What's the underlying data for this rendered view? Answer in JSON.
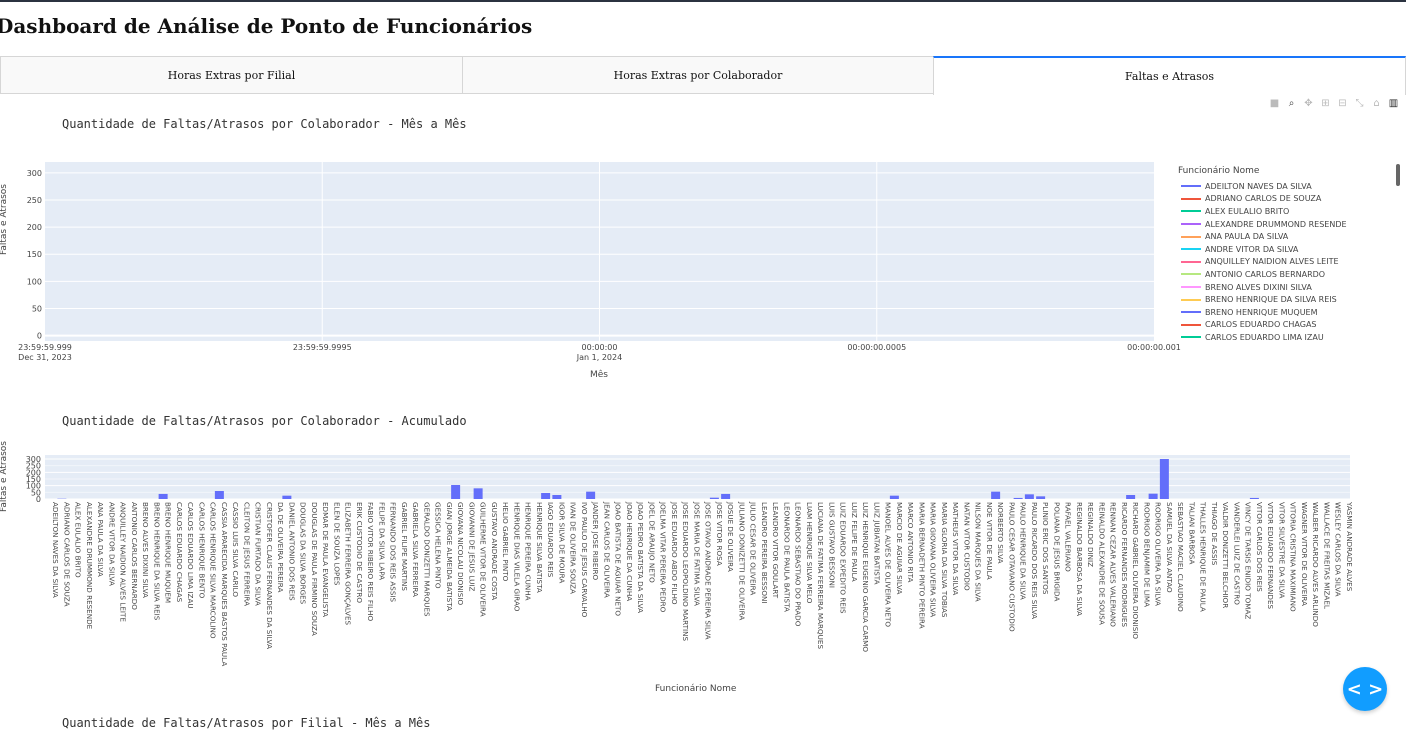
{
  "page_title": "Dashboard de Análise de Ponto de Funcionários",
  "tabs": [
    {
      "label": "Horas Extras por Filial",
      "active": false
    },
    {
      "label": "Horas Extras por Colaborador",
      "active": false
    },
    {
      "label": "Faltas e Atrasos",
      "active": true
    }
  ],
  "modebar_icons": [
    "camera-icon",
    "zoom-icon",
    "pan-icon",
    "zoom-in-icon",
    "zoom-out-icon",
    "autoscale-icon",
    "reset-axes-icon",
    "plotly-logo-icon"
  ],
  "nav_button": {
    "label": "< >",
    "icon": "code-arrows-icon",
    "color": "#119dff"
  },
  "chart_data": [
    {
      "type": "line",
      "title": "Quantidade de Faltas/Atrasos por Colaborador - Mês a Mês",
      "xlabel": "Mês",
      "ylabel": "Faltas e Atrasos",
      "ylim": [
        -10,
        320
      ],
      "yticks": [
        0,
        50,
        100,
        150,
        200,
        250,
        300
      ],
      "xticks": [
        {
          "label": "23:59:59.999",
          "sublabel": "Dec 31, 2023"
        },
        {
          "label": "23:59:59.9995",
          "sublabel": ""
        },
        {
          "label": "00:00:00",
          "sublabel": "Jan 1, 2024"
        },
        {
          "label": "00:00:00.0005",
          "sublabel": ""
        },
        {
          "label": "00:00:00.001",
          "sublabel": ""
        }
      ],
      "grid": true,
      "legend_title": "Funcionário Nome",
      "legend_position": "right",
      "series": [
        {
          "name": "ADEILTON NAVES DA SILVA",
          "color": "#636efa"
        },
        {
          "name": "ADRIANO CARLOS DE SOUZA",
          "color": "#ef553b"
        },
        {
          "name": "ALEX EULALIO BRITO",
          "color": "#00cc96"
        },
        {
          "name": "ALEXANDRE DRUMMOND RESENDE",
          "color": "#ab63fa"
        },
        {
          "name": "ANA PAULA DA SILVA",
          "color": "#ffa15a"
        },
        {
          "name": "ANDRE VITOR DA SILVA",
          "color": "#19d3f3"
        },
        {
          "name": "ANQUILLEY NAIDION ALVES LEITE",
          "color": "#ff6692"
        },
        {
          "name": "ANTONIO CARLOS BERNARDO",
          "color": "#b6e880"
        },
        {
          "name": "BRENO ALVES DIXINI SILVA",
          "color": "#ff97ff"
        },
        {
          "name": "BRENO HENRIQUE DA SILVA REIS",
          "color": "#fecb52"
        },
        {
          "name": "BRENO HENRIQUE MUQUEM",
          "color": "#636efa"
        },
        {
          "name": "CARLOS EDUARDO CHAGAS",
          "color": "#ef553b"
        },
        {
          "name": "CARLOS EDUARDO LIMA IZAU",
          "color": "#00cc96"
        }
      ]
    },
    {
      "type": "bar",
      "title": "Quantidade de Faltas/Atrasos por Colaborador - Acumulado",
      "xlabel": "Funcionário Nome",
      "ylabel": "Faltas e Atrasos",
      "ylim": [
        0,
        330
      ],
      "yticks": [
        0,
        100,
        200,
        300
      ],
      "yticks_minor": [
        50,
        150,
        250
      ],
      "color": "#636efa",
      "categories": [
        "ADEILTON NAVES DA SILVA",
        "ADRIANO CARLOS DE SOUZA",
        "ALEX EULALIO BRITO",
        "ALEXANDRE DRUMMOND RESENDE",
        "ANA PAULA DA SILVA",
        "ANDRE VITOR DA SILVA",
        "ANQUILLEY NAIDION ALVES LEITE",
        "ANTONIO CARLOS BERNARDO",
        "BRENO ALVES DIXINI SILVA",
        "BRENO HENRIQUE DA SILVA REIS",
        "BRENO HENRIQUE MUQUEM",
        "CARLOS EDUARDO CHAGAS",
        "CARLOS EDUARDO LIMA IZAU",
        "CARLOS HENRIQUE BENTO",
        "CARLOS HENRIQUE SILVA MARCOLINO",
        "CASSIA APARECIDA MARQUES BASTOS PAULA",
        "CASSIO LUIS SILVA CARILO",
        "CLEITON DE JESUS FERREIRA",
        "CRISTIAN FURTADO DA SILVA",
        "CRISTOFER CLAUS FERNANDES DA SILVA",
        "DA DE OLIVEIRA PEREIRA",
        "DANIEL ANTONIO DOS REIS",
        "DOUGLAS DA SILVA BORGES",
        "DOUGLAS DE PAULA FIRMINO SOUZA",
        "EDMAR DE PAULA EVANGELISTA",
        "ELEN DE SOUZA LOPES",
        "ELIZABETH FERREIRA GONÇALVES",
        "ERIK CUSTODIO DE CASTRO",
        "FABIO VITOR RIBEIRO REIS FILHO",
        "FELIPE DA SILVA LAPA",
        "FERNANDO DOS REIS ASSIS",
        "GABRIEL FILIPE MARTINS",
        "GABRIELA SILVA FERREIRA",
        "GERALDO DONIZETTI MARQUES",
        "GESSICA HELENA PINTO",
        "GIAN JORGE ALMEIDA BATISTA",
        "GIOVANA NICOLAU DIONISIO",
        "GIOVANNI DE JESUS LUIZ",
        "GUILHERME VITOR DE OLIVEIRA",
        "GUSTAVO ANDRADE COSTA",
        "HELIO GABRIEL PINTO",
        "HENRIQUE DIAS VILELA GIRAO",
        "HENRIQUE PEREIRA CUNHA",
        "HENRIQUE SILVA BATISTA",
        "IAGO EDUARDO REIS",
        "IGOR SILVA DE MOURA",
        "IVAN DE OLIVEIRA SOUZA",
        "IVO PAULO DE JESUS CARVALHO",
        "JANDER JOSE RIBEIRO",
        "JEAN CARLOS DE OLIVEIRA",
        "JOAO BATISTA DE AGUIAR NETO",
        "JOAO HENRIQUE DA CUNHA",
        "JOAO PEDRO BATISTA DA SILVA",
        "JOEL DE ARAUJO NETO",
        "JOELMA VITAR PEREIRA PEDRO",
        "JOSE EDUARDO ABDO FILHO",
        "JOSE EDUARDO LEOPOLDINO MARTINS",
        "JOSE MARIA DE FATIMA SILVA",
        "JOSE OTAVIO ANDRADE PEREIRA SILVA",
        "JOSE VITOR ROSA",
        "JOSUE DE OLIVEIRA",
        "JULIANO DONIZETTI DE OLIVEIRA",
        "JULIO CESAR DE OLIVEIRA",
        "LEANDRO PEREIRA BESSONI",
        "LEANDRO VITOR GOULART",
        "LEONARDO DE PAULA BATISTA",
        "LEONARDO SEBASTIAO DO PRADO",
        "LIAM HENRIQUE SILVA MELO",
        "LUCIANA DE FATIMA FERREIRA MARQUES",
        "LUIS GUSTAVO BESSONI",
        "LUIZ EDUARDO EXPEDITO REIS",
        "LUIZ FELIPE DE PAULA",
        "LUIZ HENRIQUE EUGENIO GARCIA CARMO",
        "LUIZ JUBIATAN BATISTA",
        "MANOEL ALVES DE OLIVEIRA NETO",
        "MARCIO DE AGUIAR SILVA",
        "MARCO ANTONIO RITA",
        "MARIA BERNADETH PINTO PEREIRA",
        "MARIA GIOVANA OLIVEIRA SILVA",
        "MARIA GLORIA DA SILVA TOBIAS",
        "MATHEUS VITOR DA SILVA",
        "NATAN VITOR CUSTODIO",
        "NILSON MARQUES DA SILVA",
        "NOE VITOR DE PAULA",
        "NORBERTO SILVA",
        "PAULO CESAR OTAVIANO CUSTODIO",
        "PAULO HENRIQUE DA SILVA",
        "PAULO RICARDO DOS REIS SILVA",
        "PLINIO ERIC DOS SANTOS",
        "POLIANA DE JESUS BRIGIDA",
        "RAFAEL VALERIANO",
        "REGINALDO BARBOSA DA SILVA",
        "REGINALDO DINIZ",
        "REINALDO ALEXANDRE DE SOUSA",
        "RENNAN CEZAR ALVES VALERIANO",
        "RICARDO FERNANDES RODRIGUES",
        "RICHARD GABRIEL OLIVEIRA DIONISIO",
        "RODRIGO BENJAMIM DE LIMA",
        "RODRIGO OLIVEIRA DA SILVA",
        "SAMUEL DA SILVA ANTAO",
        "SEBASTIAO MACIEL CLAUDINO",
        "TALIAN BARBOSA",
        "THALLES HENRIQUE DE PAULA",
        "THIAGO DE ASSIS",
        "VALDIR DONIZETTI BELCHIOR",
        "VANDERLEI LUIZ DE CASTRO",
        "VINCY DE TARSIS ENIDIO TOMAZ",
        "VITOR CARLOS DOS REIS",
        "VITOR EDUARDO FERNANDES",
        "VITOR SILVESTRE DA SILVA",
        "VITORIA CRISTINA MAXIMIANO",
        "WAGNER VITOR DE OLIVEIRA",
        "WALBER RICARDO ALVES ARLINDO",
        "WALLACE DE FREITAS MIZAEL",
        "WESLEY CARLOS DA SILVA",
        "YASMIN ANDRADE ALVES"
      ],
      "values": [
        0,
        2,
        0,
        0,
        0,
        0,
        0,
        0,
        0,
        0,
        38,
        0,
        0,
        0,
        0,
        60,
        0,
        0,
        0,
        0,
        0,
        25,
        0,
        0,
        0,
        0,
        0,
        0,
        0,
        0,
        0,
        0,
        0,
        0,
        0,
        0,
        105,
        0,
        80,
        0,
        0,
        0,
        0,
        0,
        45,
        30,
        0,
        0,
        55,
        0,
        0,
        0,
        0,
        0,
        0,
        0,
        0,
        0,
        0,
        10,
        38,
        0,
        0,
        0,
        0,
        0,
        0,
        0,
        0,
        0,
        0,
        0,
        0,
        0,
        0,
        25,
        0,
        0,
        0,
        0,
        0,
        0,
        0,
        0,
        55,
        0,
        8,
        35,
        20,
        0,
        0,
        0,
        0,
        0,
        0,
        0,
        30,
        0,
        40,
        300,
        0,
        0,
        0,
        0,
        0,
        0,
        0,
        8,
        0,
        0,
        0,
        0,
        0,
        0,
        0,
        0,
        0
      ]
    }
  ],
  "third_chart_title": "Quantidade de Faltas/Atrasos por Filial - Mês a Mês"
}
